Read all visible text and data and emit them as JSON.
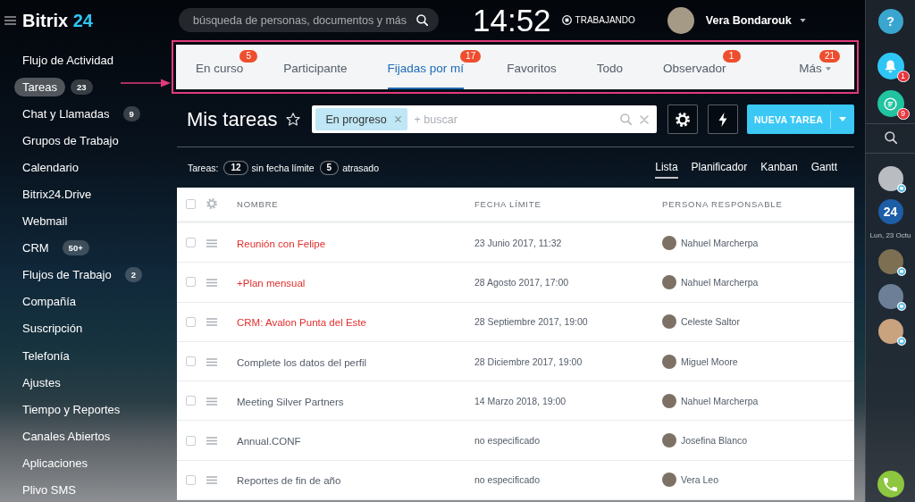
{
  "logo": {
    "name": "Bitrix",
    "number": "24"
  },
  "header": {
    "search": {
      "placeholder": "búsqueda de personas, documentos y más"
    },
    "clock": "14:52",
    "work_status": "TRABAJANDO",
    "user": {
      "name": "Vera Bondarouk"
    }
  },
  "sidebar": {
    "items": [
      {
        "label": "Flujo de Actividad",
        "selected": false
      },
      {
        "label": "Tareas",
        "selected": true,
        "counter": "23"
      },
      {
        "label": "Chat y Llamadas",
        "selected": false,
        "counter": "9"
      },
      {
        "label": "Grupos de Trabajo",
        "selected": false
      },
      {
        "label": "Calendario",
        "selected": false
      },
      {
        "label": "Bitrix24.Drive",
        "selected": false
      },
      {
        "label": "Webmail",
        "selected": false
      },
      {
        "label": "CRM",
        "selected": false,
        "counter": "50+"
      },
      {
        "label": "Flujos de Trabajo",
        "selected": false,
        "counter": "2"
      },
      {
        "label": "Compañía",
        "selected": false
      },
      {
        "label": "Suscripción",
        "selected": false
      },
      {
        "label": "Telefonía",
        "selected": false
      },
      {
        "label": "Ajustes",
        "selected": false
      },
      {
        "label": "Tiempo y Reportes",
        "selected": false
      },
      {
        "label": "Canales Abiertos",
        "selected": false
      },
      {
        "label": "Aplicaciones",
        "selected": false
      },
      {
        "label": "Plivo SMS",
        "selected": false
      }
    ]
  },
  "tabs": [
    {
      "label": "En curso",
      "selected": false,
      "badge": "5",
      "dropdown": false
    },
    {
      "label": "Participante",
      "selected": false,
      "dropdown": false
    },
    {
      "label": "Fijadas por mí",
      "selected": true,
      "badge": "17",
      "dropdown": false
    },
    {
      "label": "Favoritos",
      "selected": false,
      "dropdown": false
    },
    {
      "label": "Todo",
      "selected": false,
      "dropdown": false
    },
    {
      "label": "Observador",
      "selected": false,
      "badge": "1",
      "dropdown": false
    },
    {
      "label": "Más",
      "selected": false,
      "badge": "21",
      "dropdown": true
    }
  ],
  "toolbar": {
    "title": "Mis tareas",
    "starred": false,
    "filter": {
      "chips": [
        {
          "label": "En progreso"
        }
      ],
      "placeholder": "+ buscar"
    },
    "create_button": {
      "label": "NUEVA TAREA"
    }
  },
  "counters": {
    "label": "Tareas:",
    "items": [
      {
        "count": "12",
        "label": "sin fecha límite"
      },
      {
        "count": "5",
        "label": "atrasado"
      }
    ]
  },
  "views": [
    {
      "label": "Lista",
      "selected": true
    },
    {
      "label": "Planificador",
      "selected": false
    },
    {
      "label": "Kanban",
      "selected": false
    },
    {
      "label": "Gantt",
      "selected": false
    }
  ],
  "table": {
    "all_checked": false,
    "columns": [
      "NOMBRE",
      "FECHA LÍMITE",
      "PERSONA RESPONSABLE"
    ],
    "rows": [
      {
        "name": "Reunión con Felipe",
        "overdue": true,
        "checked": false,
        "deadline": "23 Junio 2017, 11:32",
        "responsible": "Nahuel Marcherpa"
      },
      {
        "name": "+Plan mensual",
        "overdue": true,
        "checked": false,
        "deadline": "28 Agosto 2017, 17:00",
        "responsible": "Nahuel Marcherpa"
      },
      {
        "name": "CRM: Avalon Punta del Este",
        "overdue": true,
        "checked": false,
        "deadline": "28 Septiembre 2017, 19:00",
        "responsible": "Celeste Saltor"
      },
      {
        "name": "Complete los datos del perfil",
        "overdue": false,
        "checked": false,
        "deadline": "28 Diciembre 2017, 19:00",
        "responsible": "Miguel Moore"
      },
      {
        "name": "Meeting Silver Partners",
        "overdue": false,
        "checked": false,
        "deadline": "14 Marzo 2018, 19:00",
        "responsible": "Nahuel Marcherpa"
      },
      {
        "name": "Annual.CONF",
        "overdue": false,
        "checked": false,
        "deadline": "no especificado",
        "responsible": "Josefina Blanco"
      },
      {
        "name": "Reportes de fin de año",
        "overdue": false,
        "checked": false,
        "deadline": "no especificado",
        "responsible": "Vera Leo"
      }
    ]
  },
  "right_bar": {
    "help": "?",
    "notifications_badge": "1",
    "chats_badge": "9",
    "calendar_day": "24",
    "date": "Lun, 23 Octu"
  }
}
